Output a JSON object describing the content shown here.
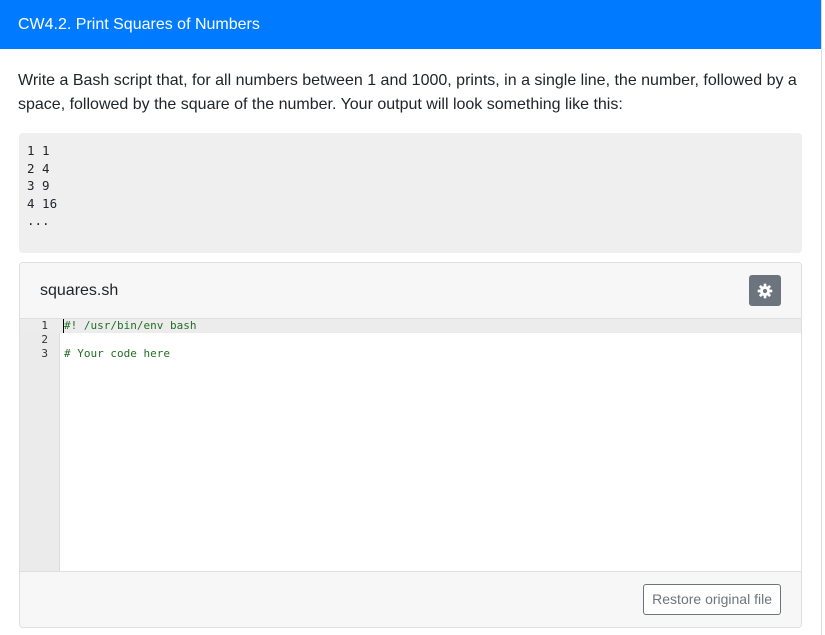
{
  "header": {
    "title": "CW4.2. Print Squares of Numbers"
  },
  "description": "Write a Bash script that, for all numbers between 1 and 1000, prints, in a single line, the number, followed by a space, followed by the square of the number. Your output will look something like this:",
  "example_output": "1 1\n2 4\n3 9\n4 16\n...",
  "editor": {
    "file_name": "squares.sh",
    "settings_icon": "gear-icon",
    "lines": [
      {
        "number": "1",
        "text": "#! /usr/bin/env bash"
      },
      {
        "number": "2",
        "text": ""
      },
      {
        "number": "3",
        "text": "# Your code here"
      }
    ],
    "restore_label": "Restore original file"
  },
  "colors": {
    "header_bg": "#007bff",
    "settings_button": "#6c757d",
    "code_comment": "#236e25"
  }
}
